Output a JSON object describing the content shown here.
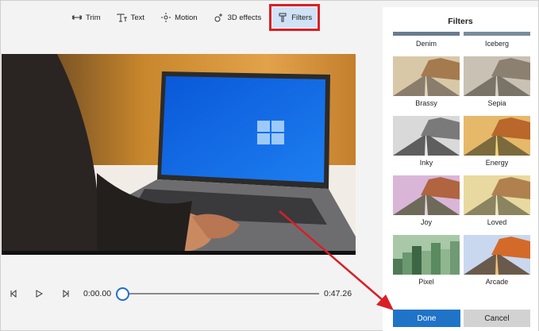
{
  "toolbar": {
    "trim": "Trim",
    "text": "Text",
    "motion": "Motion",
    "effects3d": "3D effects",
    "filters": "Filters"
  },
  "playback": {
    "current_time": "0:00.00",
    "duration": "0:47.26",
    "progress": 0
  },
  "filters_panel": {
    "title": "Filters",
    "filters": [
      {
        "label": "Denim"
      },
      {
        "label": "Iceberg"
      },
      {
        "label": "Brassy"
      },
      {
        "label": "Sepia"
      },
      {
        "label": "Inky"
      },
      {
        "label": "Energy"
      },
      {
        "label": "Joy"
      },
      {
        "label": "Loved"
      },
      {
        "label": "Pixel"
      },
      {
        "label": "Arcade"
      }
    ],
    "done_label": "Done",
    "cancel_label": "Cancel"
  },
  "colors": {
    "accent": "#1f74c8",
    "highlight_red": "#d81f26",
    "active_tab_bg": "#cfe2f6"
  }
}
